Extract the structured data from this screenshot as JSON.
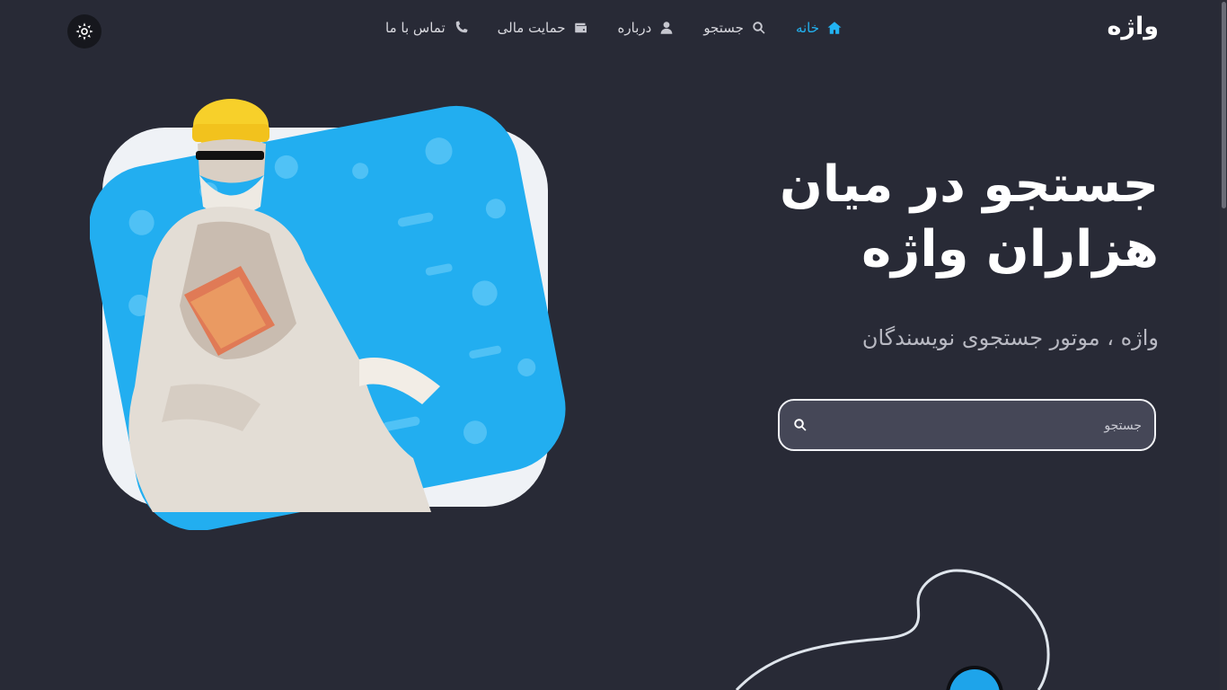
{
  "nav": {
    "brand": "واژه",
    "items": [
      {
        "label": "خانه",
        "icon": "home-icon",
        "active": true
      },
      {
        "label": "جستجو",
        "icon": "search-icon",
        "active": false
      },
      {
        "label": "درباره",
        "icon": "user-icon",
        "active": false
      },
      {
        "label": "حمایت مالی",
        "icon": "wallet-icon",
        "active": false
      },
      {
        "label": "تماس با ما",
        "icon": "phone-icon",
        "active": false
      }
    ],
    "theme_toggle_icon": "sun-icon"
  },
  "hero": {
    "title": "جستجو در میان هزاران واژه",
    "subtitle": "واژه ، موتور جستجوی نویسندگان",
    "search": {
      "placeholder": "جستجو",
      "value": ""
    }
  },
  "colors": {
    "background": "#282a36",
    "accent": "#22b3f2",
    "text": "#ffffff",
    "muted": "#b8b9c2",
    "search_bg": "#454757"
  }
}
